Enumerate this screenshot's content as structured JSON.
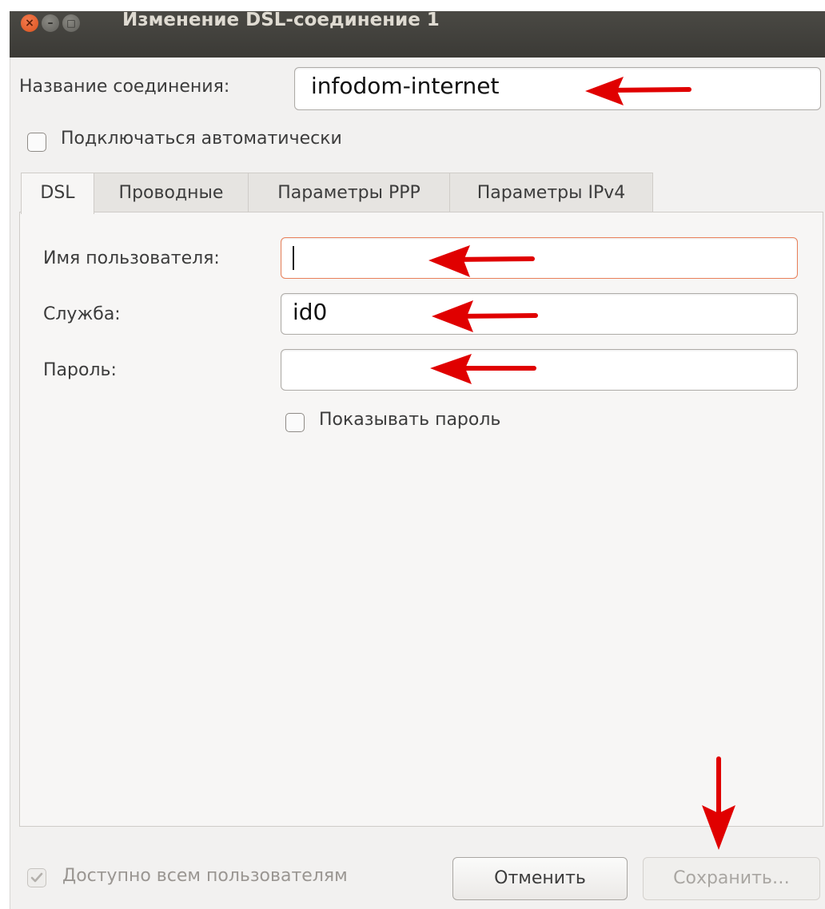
{
  "window": {
    "title": "Изменение DSL-соединение 1"
  },
  "connection": {
    "name_label": "Название соединения:",
    "name_value": "infodom-internet",
    "auto_connect_label": "Подключаться автоматически"
  },
  "tabs": [
    {
      "label": "DSL"
    },
    {
      "label": "Проводные"
    },
    {
      "label": "Параметры PPP"
    },
    {
      "label": "Параметры IPv4"
    }
  ],
  "dsl": {
    "username_label": "Имя пользователя:",
    "username_value": "",
    "service_label": "Служба:",
    "service_value": "id0",
    "password_label": "Пароль:",
    "password_value": "",
    "show_password_label": "Показывать пароль"
  },
  "footer": {
    "all_users_label": "Доступно всем пользователям",
    "cancel_label": "Отменить",
    "save_label": "Сохранить…"
  },
  "colors": {
    "annotation_arrow": "#e00000",
    "titlebar": "#3f3e3a",
    "close_button": "#e95d2a"
  },
  "icons": [
    "close-icon",
    "minimize-icon",
    "maximize-icon",
    "checkmark-icon",
    "annotation-arrow-left",
    "annotation-arrow-down"
  ]
}
